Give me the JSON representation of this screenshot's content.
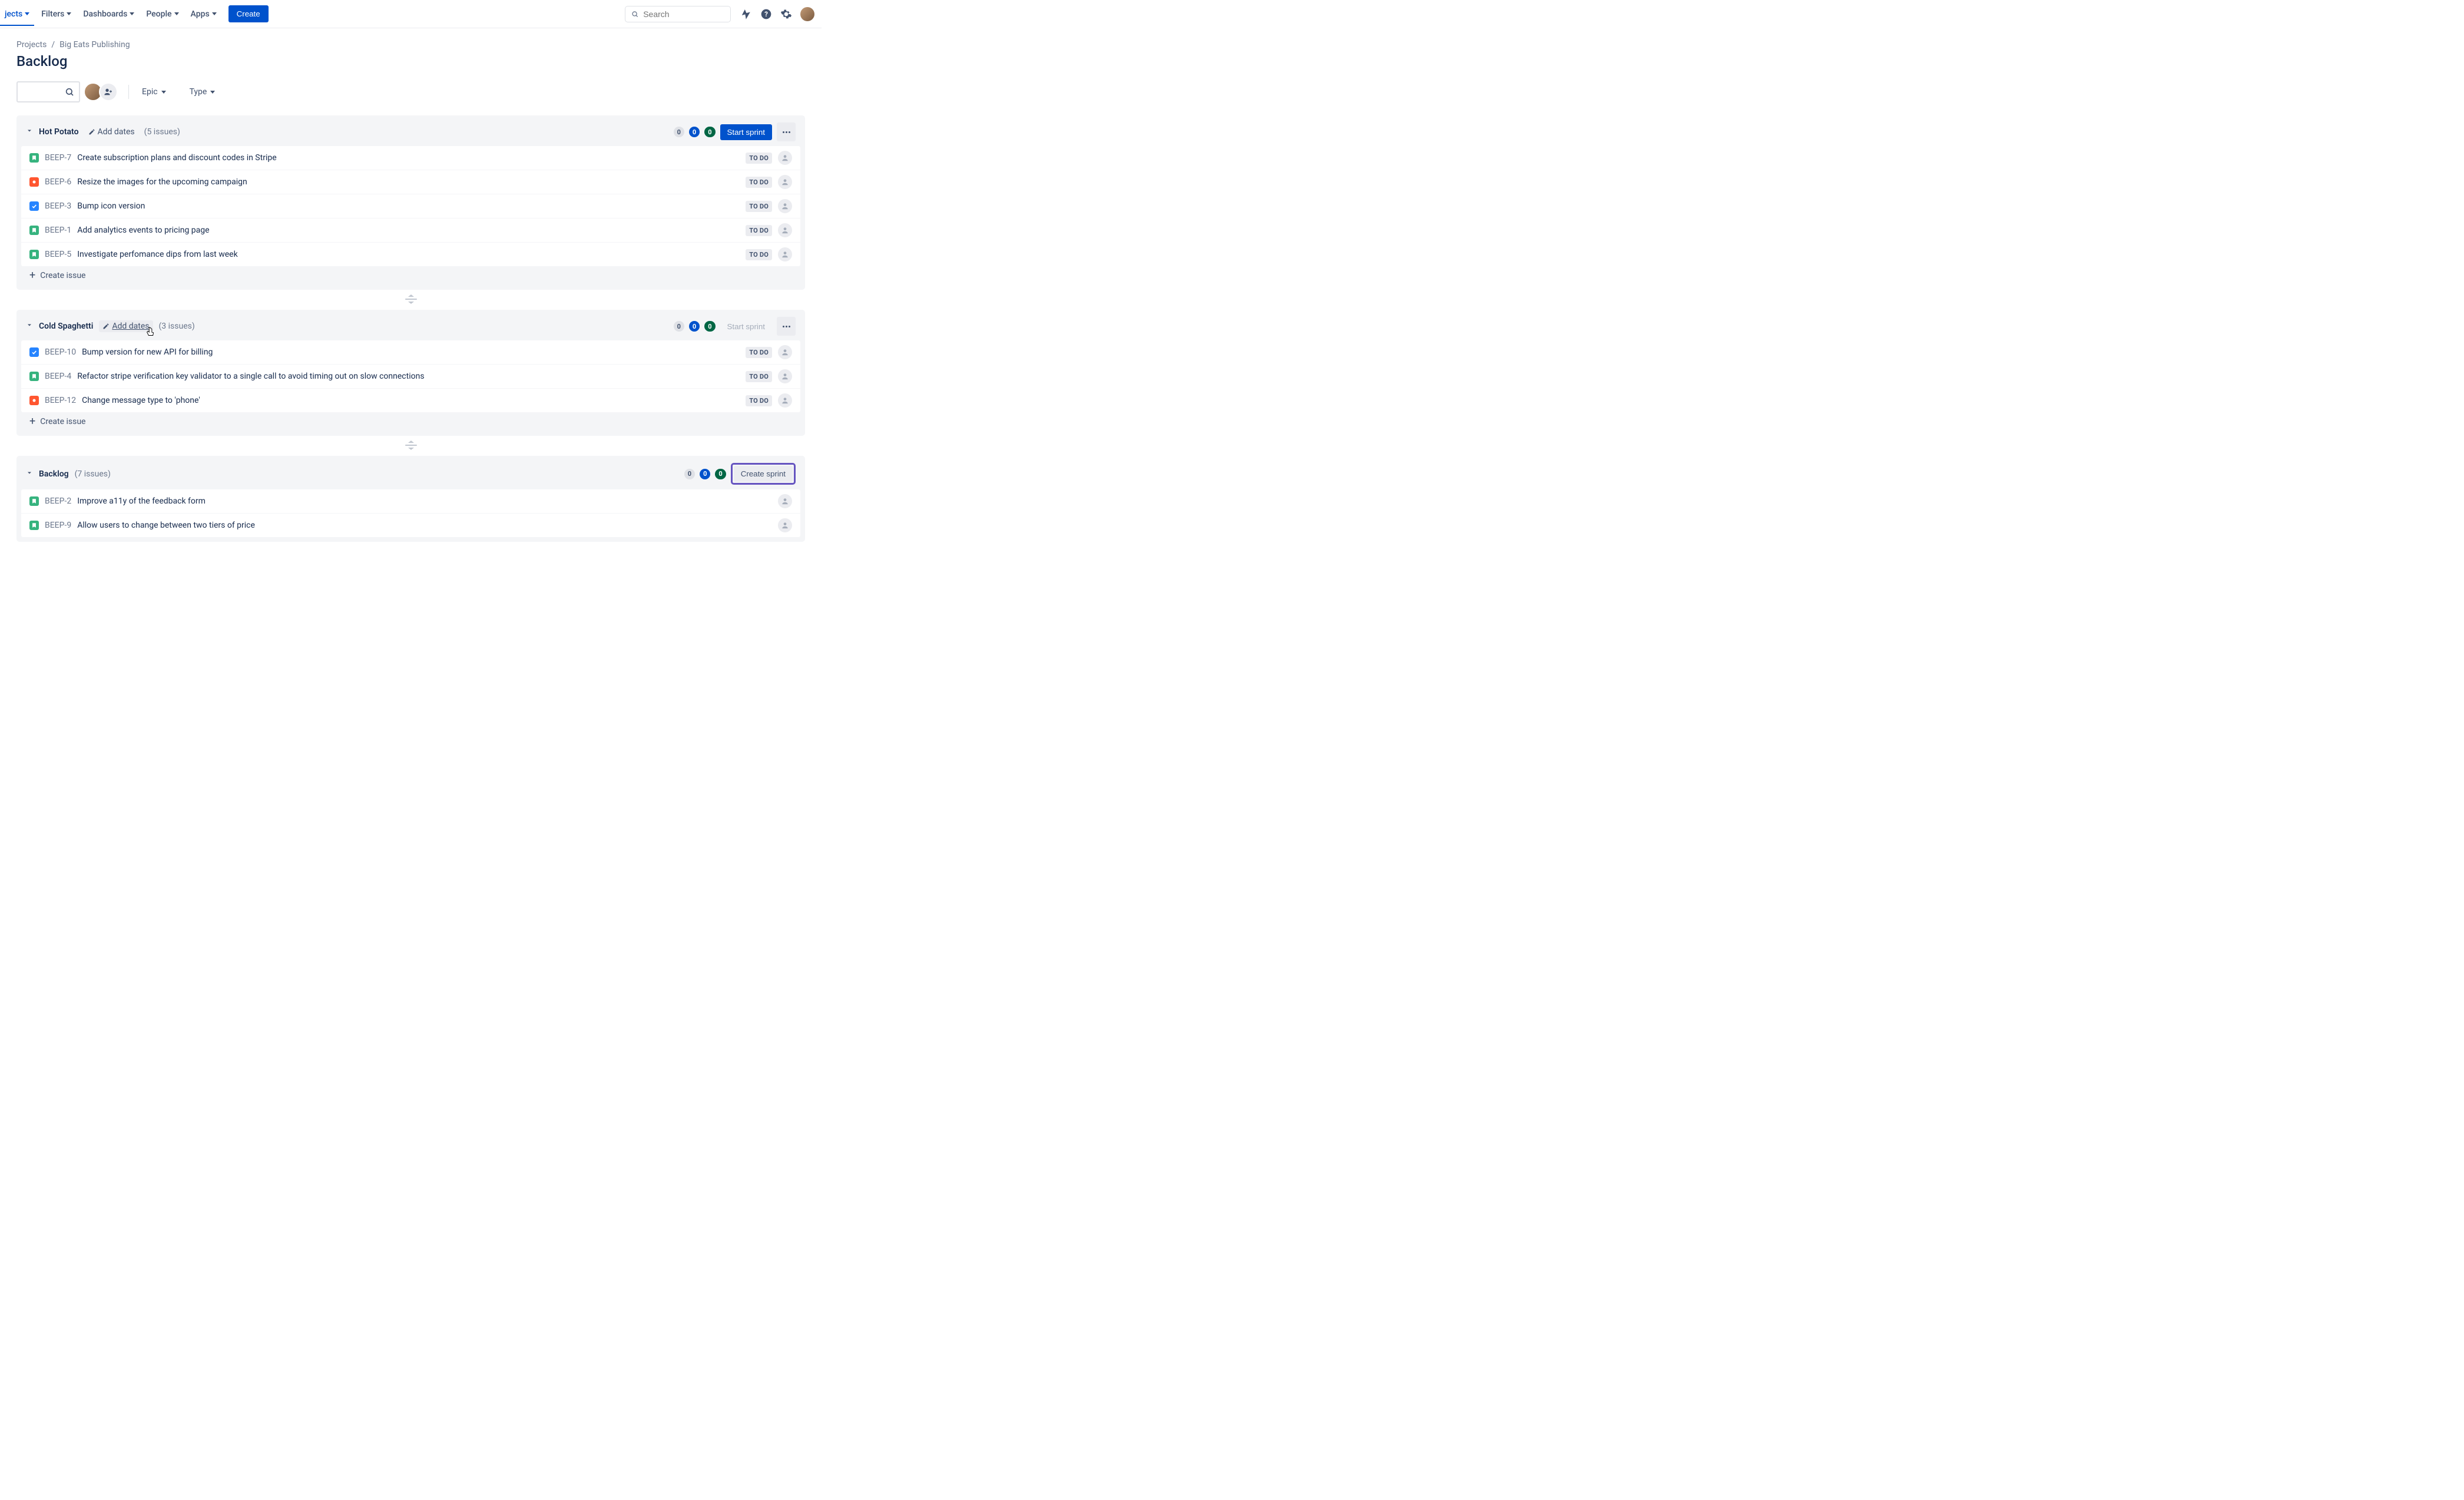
{
  "nav": {
    "items": [
      "jects",
      "Filters",
      "Dashboards",
      "People",
      "Apps"
    ],
    "create": "Create",
    "search_placeholder": "Search"
  },
  "breadcrumbs": {
    "root": "Projects",
    "project": "Big Eats Publishing"
  },
  "page_title": "Backlog",
  "filters": {
    "epic": "Epic",
    "type": "Type"
  },
  "sprints": [
    {
      "name": "Hot Potato",
      "add_dates": "Add dates",
      "count_label": "(5 issues)",
      "counts": {
        "grey": "0",
        "blue": "0",
        "green": "0"
      },
      "action_label": "Start sprint",
      "action_kind": "primary",
      "add_dates_hover": false,
      "issues": [
        {
          "type": "story",
          "key": "BEEP-7",
          "summary": "Create subscription plans and discount codes in Stripe",
          "status": "TO DO"
        },
        {
          "type": "bug",
          "key": "BEEP-6",
          "summary": "Resize the images for the upcoming campaign",
          "status": "TO DO"
        },
        {
          "type": "task",
          "key": "BEEP-3",
          "summary": "Bump icon version",
          "status": "TO DO"
        },
        {
          "type": "story",
          "key": "BEEP-1",
          "summary": "Add analytics events to pricing page",
          "status": "TO DO"
        },
        {
          "type": "story",
          "key": "BEEP-5",
          "summary": "Investigate perfomance dips from last week",
          "status": "TO DO"
        }
      ],
      "create_issue": "Create issue"
    },
    {
      "name": "Cold Spaghetti",
      "add_dates": "Add dates",
      "count_label": "(3 issues)",
      "counts": {
        "grey": "0",
        "blue": "0",
        "green": "0"
      },
      "action_label": "Start sprint",
      "action_kind": "disabled",
      "add_dates_hover": true,
      "issues": [
        {
          "type": "task",
          "key": "BEEP-10",
          "summary": "Bump version for new API for billing",
          "status": "TO DO"
        },
        {
          "type": "story",
          "key": "BEEP-4",
          "summary": "Refactor stripe verification key validator to a single call to avoid timing out on slow connections",
          "status": "TO DO"
        },
        {
          "type": "bug",
          "key": "BEEP-12",
          "summary": "Change message type to 'phone'",
          "status": "TO DO"
        }
      ],
      "create_issue": "Create issue"
    }
  ],
  "backlog": {
    "name": "Backlog",
    "count_label": "(7 issues)",
    "counts": {
      "grey": "0",
      "blue": "0",
      "green": "0"
    },
    "action_label": "Create sprint",
    "issues": [
      {
        "type": "story",
        "key": "BEEP-2",
        "summary": "Improve a11y of the feedback form",
        "status": ""
      },
      {
        "type": "story",
        "key": "BEEP-9",
        "summary": "Allow users to change between two tiers of price",
        "status": ""
      }
    ]
  }
}
